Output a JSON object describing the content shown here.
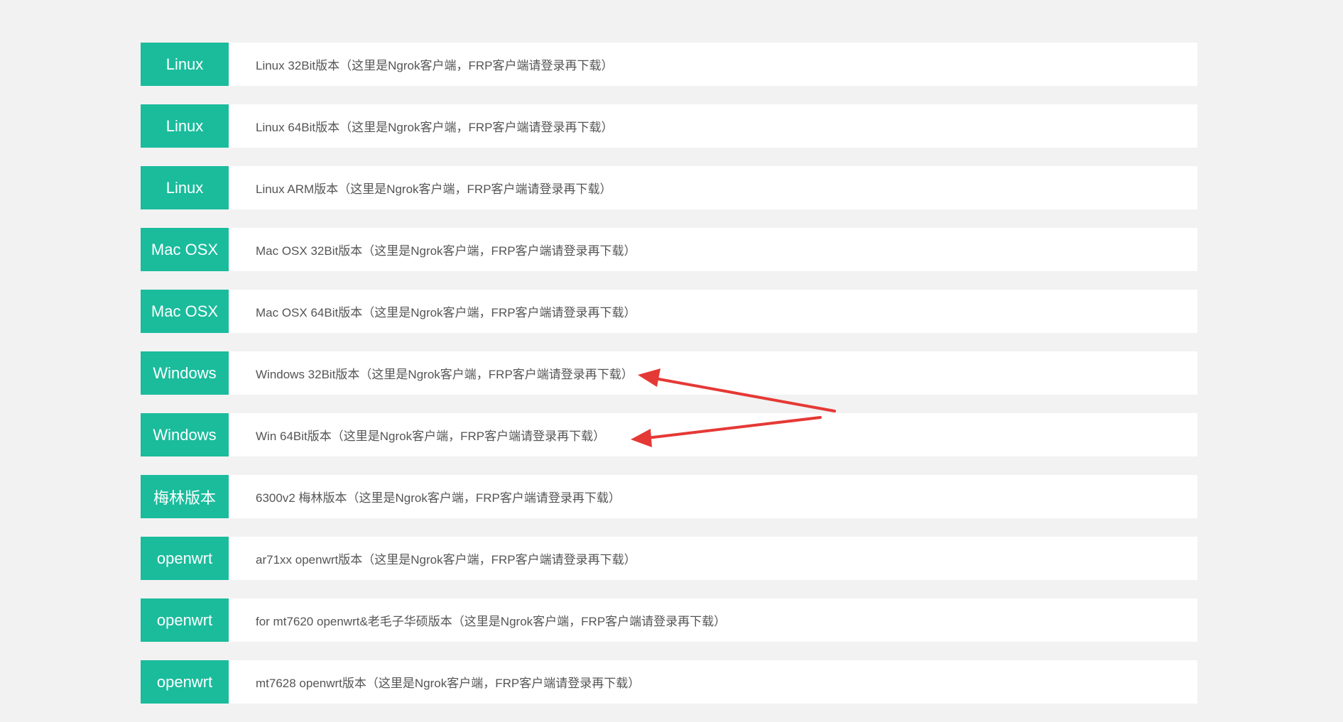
{
  "colors": {
    "background": "#f2f2f2",
    "row_background": "#ffffff",
    "tag_background": "#1abc9c",
    "tag_text": "#ffffff",
    "desc_text": "#555555",
    "annotation_arrow": "#e53935"
  },
  "downloads": [
    {
      "platform": "Linux",
      "description": "Linux 32Bit版本（这里是Ngrok客户端，FRP客户端请登录再下载）"
    },
    {
      "platform": "Linux",
      "description": "Linux 64Bit版本（这里是Ngrok客户端，FRP客户端请登录再下载）"
    },
    {
      "platform": "Linux",
      "description": "Linux ARM版本（这里是Ngrok客户端，FRP客户端请登录再下载）"
    },
    {
      "platform": "Mac OSX",
      "description": "Mac OSX 32Bit版本（这里是Ngrok客户端，FRP客户端请登录再下载）"
    },
    {
      "platform": "Mac OSX",
      "description": "Mac OSX 64Bit版本（这里是Ngrok客户端，FRP客户端请登录再下载）"
    },
    {
      "platform": "Windows",
      "description": "Windows 32Bit版本（这里是Ngrok客户端，FRP客户端请登录再下载）"
    },
    {
      "platform": "Windows",
      "description": "Win 64Bit版本（这里是Ngrok客户端，FRP客户端请登录再下载）"
    },
    {
      "platform": "梅林版本",
      "description": "6300v2 梅林版本（这里是Ngrok客户端，FRP客户端请登录再下载）"
    },
    {
      "platform": "openwrt",
      "description": "ar71xx openwrt版本（这里是Ngrok客户端，FRP客户端请登录再下载）"
    },
    {
      "platform": "openwrt",
      "description": "for mt7620 openwrt&老毛子华硕版本（这里是Ngrok客户端，FRP客户端请登录再下载）"
    },
    {
      "platform": "openwrt",
      "description": "mt7628 openwrt版本（这里是Ngrok客户端，FRP客户端请登录再下载）"
    }
  ]
}
